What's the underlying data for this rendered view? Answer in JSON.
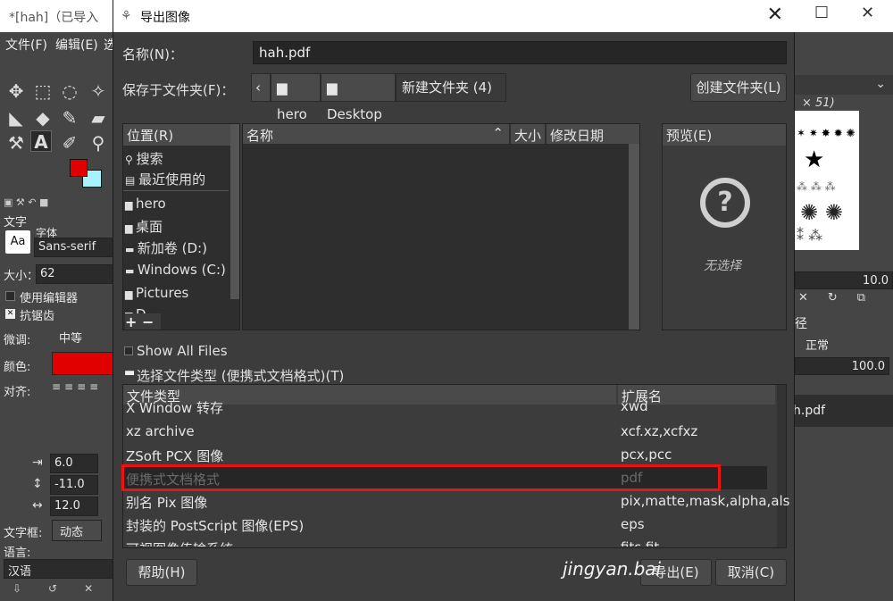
{
  "gimp": {
    "title": "*[hah]（已导入",
    "menu": [
      "文件(F)",
      "编辑(E)",
      "选"
    ],
    "tool_options": {
      "section_label": "文字",
      "font_label": "字体",
      "font_value": "Sans-serif",
      "size_label": "大小：",
      "size_value": "62",
      "use_editor": "使用编辑器",
      "antialias": "抗锯齿",
      "hinting_label": "微调:",
      "hinting_value": "中等",
      "color_label": "颜色:",
      "justify_label": "对齐:",
      "indent_value": "6.0",
      "line_spacing_value": "-11.0",
      "letter_spacing_value": "12.0",
      "box_label": "文字框:",
      "box_value": "动态",
      "language_label": "语言:",
      "language_value": "汉语"
    },
    "right_dock": {
      "brush_size": "× 51)",
      "spacing": "10.0",
      "path_tab": "径",
      "mode": "正常",
      "opacity": "100.0",
      "layer_name": "h.pdf"
    },
    "colors": {
      "foreground": "#e10000",
      "background": "#a6f3ff"
    }
  },
  "dialog": {
    "title": "导出图像",
    "name_label": "名称(N)：",
    "name_value": "hah.pdf",
    "save_in_label": "保存于文件夹(F)：",
    "breadcrumbs": [
      "hero",
      "Desktop",
      "新建文件夹 (4)"
    ],
    "create_folder": "创建文件夹(L)",
    "places_header": "位置(R)",
    "places": [
      {
        "label": "搜索",
        "icon": "search-icon"
      },
      {
        "label": "最近使用的",
        "icon": "recent-icon"
      },
      {
        "label": "hero",
        "icon": "folder-icon"
      },
      {
        "label": "桌面",
        "icon": "folder-icon"
      },
      {
        "label": "新加卷 (D:)",
        "icon": "drive-icon"
      },
      {
        "label": "Windows (C:)",
        "icon": "drive-icon"
      },
      {
        "label": "Pictures",
        "icon": "folder-icon"
      },
      {
        "label": "D",
        "icon": "folder-icon"
      }
    ],
    "files_columns": {
      "name": "名称",
      "size": "大小",
      "modified": "修改日期"
    },
    "preview_header": "预览(E)",
    "preview_empty": "无选择",
    "show_all_files": "Show All Files",
    "file_type_expander": "选择文件类型 (便携式文档格式)(T)",
    "ft_columns": {
      "type": "文件类型",
      "ext": "扩展名"
    },
    "file_types": [
      {
        "name": "X Window 转存",
        "ext": "xwd"
      },
      {
        "name": "xz archive",
        "ext": "xcf.xz,xcfxz"
      },
      {
        "name": "ZSoft PCX 图像",
        "ext": "pcx,pcc"
      },
      {
        "name": "便携式文档格式",
        "ext": "pdf"
      },
      {
        "name": "别名 Pix 图像",
        "ext": "pix,matte,mask,alpha,als"
      },
      {
        "name": "封装的 PostScript 图像(EPS)",
        "ext": "eps"
      },
      {
        "name": "可视图像传输系统",
        "ext": "fits,fit"
      }
    ],
    "help_button": "帮助(H)",
    "export_button": "导出(E)",
    "cancel_button": "取消(C)"
  },
  "watermark": "jingyan.bai"
}
